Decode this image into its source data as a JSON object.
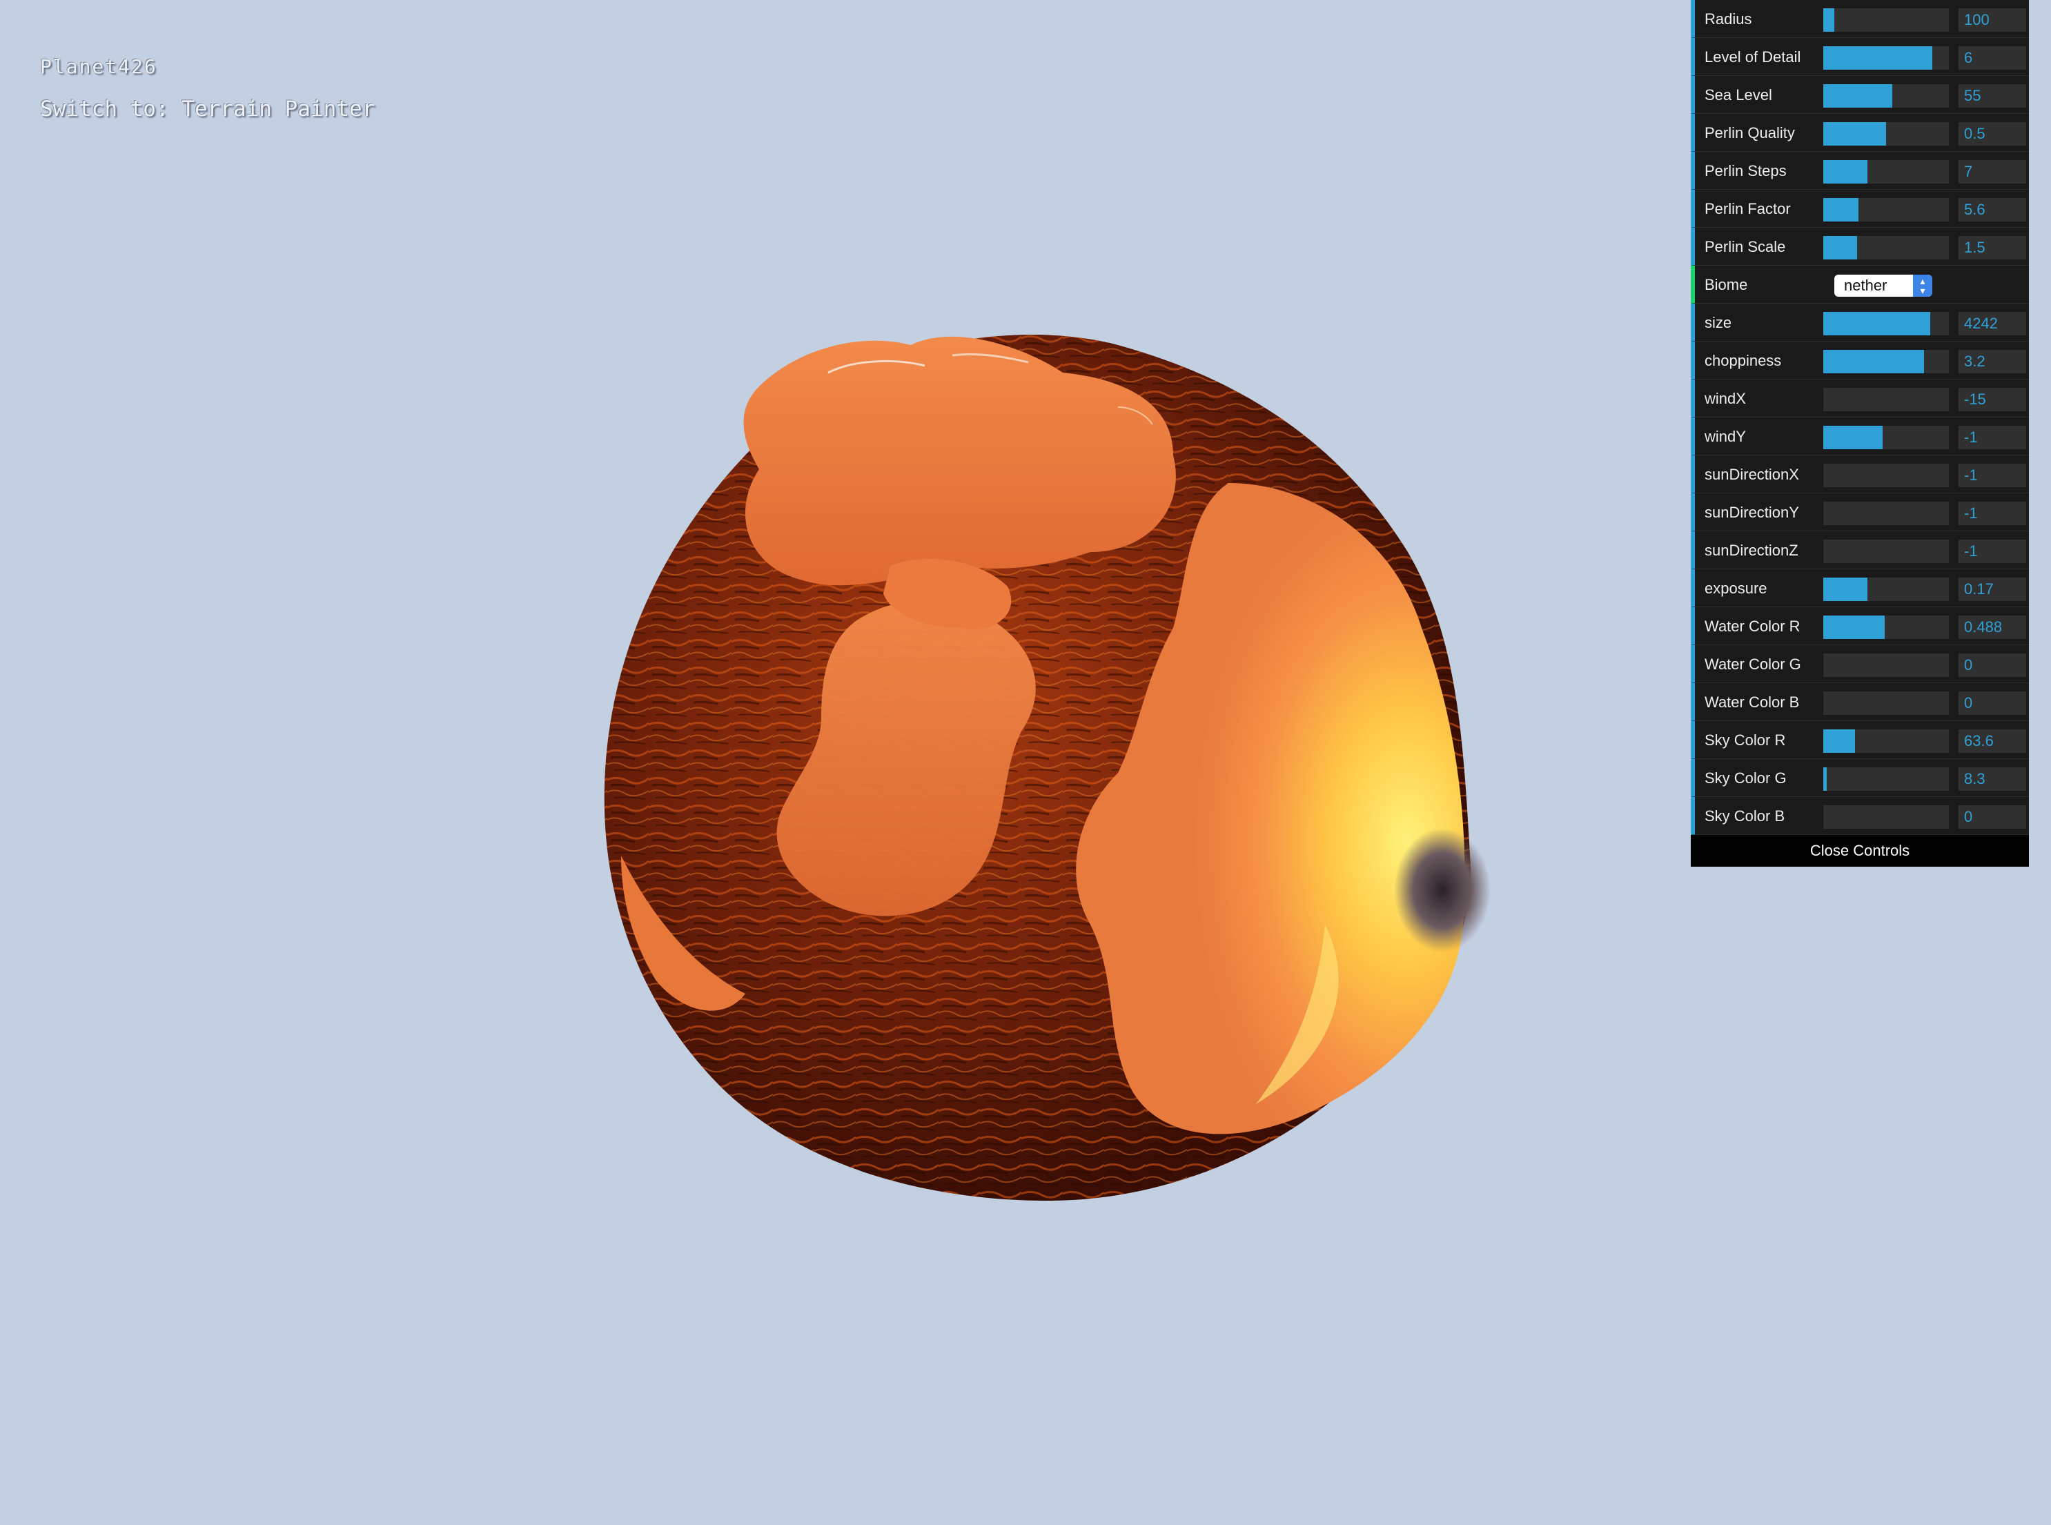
{
  "app": {
    "title": "Planet426",
    "switch_prefix": "Switch to:",
    "switch_target": "Terrain Painter"
  },
  "planet": {
    "theme": "lava/nether biome sphere",
    "colors": {
      "dark_rock": "#5a1a08",
      "rock_highlight": "#e0601a",
      "lava_surface": "#f07a3a",
      "lava_hot": "#ffe060",
      "shadow": "#2a1a1a"
    }
  },
  "controls": {
    "accent_color": "#2fa1d6",
    "rows": [
      {
        "label": "Radius",
        "value": "100",
        "fill": 0.09
      },
      {
        "label": "Level of Detail",
        "value": "6",
        "fill": 0.87
      },
      {
        "label": "Sea Level",
        "value": "55",
        "fill": 0.55
      },
      {
        "label": "Perlin Quality",
        "value": "0.5",
        "fill": 0.5
      },
      {
        "label": "Perlin Steps",
        "value": "7",
        "fill": 0.35
      },
      {
        "label": "Perlin Factor",
        "value": "5.6",
        "fill": 0.28
      },
      {
        "label": "Perlin Scale",
        "value": "1.5",
        "fill": 0.27
      }
    ],
    "biome": {
      "label": "Biome",
      "selected": "nether"
    },
    "rows2": [
      {
        "label": "size",
        "value": "4242",
        "fill": 0.85
      },
      {
        "label": "choppiness",
        "value": "3.2",
        "fill": 0.8
      },
      {
        "label": "windX",
        "value": "-15",
        "fill": 0.0
      },
      {
        "label": "windY",
        "value": "-1",
        "fill": 0.47
      },
      {
        "label": "sunDirectionX",
        "value": "-1",
        "fill": 0.0
      },
      {
        "label": "sunDirectionY",
        "value": "-1",
        "fill": 0.0
      },
      {
        "label": "sunDirectionZ",
        "value": "-1",
        "fill": 0.0
      },
      {
        "label": "exposure",
        "value": "0.17",
        "fill": 0.35
      },
      {
        "label": "Water Color R",
        "value": "0.488",
        "fill": 0.49
      },
      {
        "label": "Water Color G",
        "value": "0",
        "fill": 0.0
      },
      {
        "label": "Water Color B",
        "value": "0",
        "fill": 0.0
      },
      {
        "label": "Sky Color R",
        "value": "63.6",
        "fill": 0.25
      },
      {
        "label": "Sky Color G",
        "value": "8.3",
        "fill": 0.03
      },
      {
        "label": "Sky Color B",
        "value": "0",
        "fill": 0.0
      }
    ],
    "close_label": "Close Controls"
  }
}
